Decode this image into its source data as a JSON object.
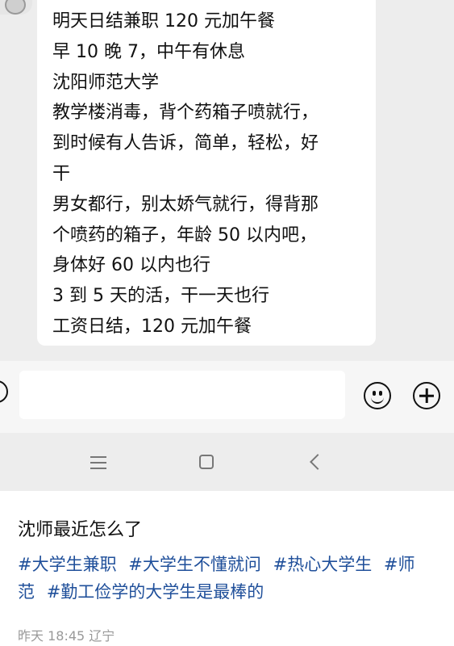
{
  "chat": {
    "message_lines": [
      "明天日结兼职 120 元加午餐",
      "早 10 晚 7，中午有休息",
      "沈阳师范大学",
      "教学楼消毒，背个药箱子喷就行，",
      "到时候有人告诉，简单，轻松，好",
      "干",
      "男女都行，别太娇气就行，得背那",
      "个喷药的箱子，年龄 50 以内吧，",
      "身体好 60 以内也行",
      "3 到 5 天的活，干一天也行",
      "工资日结，120 元加午餐"
    ]
  },
  "input_bar": {
    "text_value": "",
    "voice_icon": "voice-icon",
    "emoji_icon": "emoji-smile-icon",
    "more_icon": "plus-circle-icon"
  },
  "nav_bar": {
    "menu_icon": "menu-icon",
    "home_icon": "home-square-icon",
    "back_icon": "back-chevron-icon"
  },
  "post": {
    "title": "沈师最近怎么了",
    "hashtags": [
      "#大学生兼职",
      "#大学生不懂就问",
      "#热心大学生",
      "#师范",
      "#勤工俭学的大学生是最棒的"
    ],
    "meta": "昨天 18:45 辽宁"
  },
  "colors": {
    "chat_background": "#ededed",
    "bubble": "#ffffff",
    "hashtag": "#1f4f9a",
    "meta_text": "#999999"
  }
}
